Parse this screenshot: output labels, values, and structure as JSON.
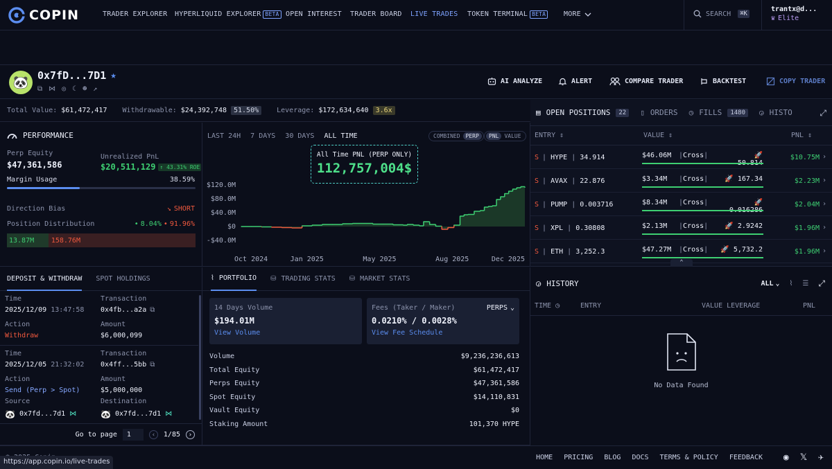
{
  "nav": {
    "logo": "COPIN",
    "items": [
      {
        "label": "TRADER EXPLORER",
        "beta": false,
        "active": false
      },
      {
        "label": "HYPERLIQUID EXPLORER",
        "beta": true,
        "active": false
      },
      {
        "label": "OPEN INTEREST",
        "beta": false,
        "active": false
      },
      {
        "label": "TRADER BOARD",
        "beta": false,
        "active": false
      },
      {
        "label": "LIVE TRADES",
        "beta": false,
        "active": true
      },
      {
        "label": "TOKEN TERMINAL",
        "beta": true,
        "active": false
      }
    ],
    "beta_label": "BETA",
    "more": "MORE",
    "search": "SEARCH",
    "shortcut": "⌘K",
    "user": "trantx@d...",
    "tier": "Elite"
  },
  "trader": {
    "address": "0x7fD...7D1",
    "buttons": [
      "AI ANALYZE",
      "ALERT",
      "COMPARE TRADER",
      "BACKTEST",
      "COPY TRADER"
    ]
  },
  "stats": {
    "total_value_label": "Total Value:",
    "total_value": "$61,472,417",
    "withdrawable_label": "Withdrawable:",
    "withdrawable": "$24,392,748",
    "withdrawable_pct": "51.50%",
    "leverage_label": "Leverage:",
    "leverage": "$172,634,640",
    "leverage_x": "3.6x"
  },
  "performance": {
    "title": "PERFORMANCE",
    "perp_equity_label": "Perp Equity",
    "perp_equity": "$47,361,586",
    "upnl_label": "Unrealized PnL",
    "upnl": "$20,511,129",
    "upnl_roe": "↑ 43.31% ROE",
    "margin_label": "Margin Usage",
    "margin_value": "38.59%",
    "margin_fraction": 0.3859,
    "direction_label": "Direction Bias",
    "direction_value": "SHORT",
    "distribution_label": "Position Distribution",
    "dist_long": "8.04%",
    "dist_short": "91.96%",
    "long_value": "13.87M",
    "short_value": "158.76M",
    "long_fraction": 0.0804
  },
  "chart_tabs": {
    "periods": [
      "LAST 24H",
      "7 DAYS",
      "30 DAYS",
      "ALL TIME"
    ],
    "active": "ALL TIME",
    "toggle1": [
      "COMBINED",
      "PERP"
    ],
    "toggle2": [
      "PNL",
      "VALUE"
    ]
  },
  "chart_data": {
    "type": "area",
    "title": "All Time PNL (PERP ONLY)",
    "headline": "112,757,004$",
    "yticks": [
      "$120.0M",
      "$80.0M",
      "$40.0M",
      "$0",
      "-$40.0M"
    ],
    "xticks": [
      "Oct 2024",
      "Jan 2025",
      "May 2025",
      "Aug 2025",
      "Dec 2025"
    ],
    "ylim": [
      -40,
      120
    ],
    "xlim": [
      0,
      14
    ],
    "x": [
      0,
      0.5,
      1,
      1.5,
      2,
      2.5,
      3,
      3.5,
      4,
      4.5,
      5,
      5.5,
      6,
      6.5,
      7,
      7.5,
      8,
      8.2,
      8.5,
      8.8,
      9,
      9.3,
      9.6,
      9.9,
      10.2,
      10.5,
      10.8,
      11,
      11.2,
      11.5,
      11.8,
      12,
      12.2,
      12.4,
      12.6,
      12.8,
      13,
      13.2,
      13.4,
      13.6,
      13.8,
      14
    ],
    "values": [
      0,
      0,
      -1,
      -2,
      -3,
      -4,
      2,
      4,
      6,
      6,
      8,
      9,
      9,
      7,
      7,
      5,
      4,
      6,
      4,
      2,
      14,
      6,
      1,
      -8,
      -3,
      4,
      30,
      34,
      35,
      44,
      46,
      56,
      58,
      60,
      78,
      86,
      95,
      102,
      108,
      112,
      115,
      113
    ]
  },
  "dw": {
    "tabs": [
      "DEPOSIT & WITHDRAW",
      "SPOT HOLDINGS"
    ],
    "time_label": "Time",
    "tx_label": "Transaction",
    "action_label": "Action",
    "amount_label": "Amount",
    "source_label": "Source",
    "dest_label": "Destination",
    "entries": [
      {
        "date": "2025/12/09",
        "time": "13:47:58",
        "tx": "0x4fb...a2a",
        "action": "Withdraw",
        "amount": "$6,000,099"
      },
      {
        "date": "2025/12/05",
        "time": "21:32:02",
        "tx": "0x4ff...5bb",
        "action": "Send (Perp > Spot)",
        "amount": "$5,000,000",
        "source": "0x7fd...7d1",
        "dest": "0x7fd...7d1"
      }
    ],
    "goto_label": "Go to page",
    "page": "1",
    "page_of": "1/85"
  },
  "portfolio": {
    "tabs": [
      "PORTFOLIO",
      "TRADING STATS",
      "MARKET STATS"
    ],
    "vol_label": "14 Days Volume",
    "vol_value": "$194.01M",
    "vol_link": "View Volume",
    "fee_label": "Fees (Taker / Maker)",
    "fee_type": "PERPS",
    "fee_value": "0.0210% / 0.0028%",
    "fee_link": "View Fee Schedule",
    "rows": [
      {
        "k": "Volume",
        "v": "$9,236,236,613"
      },
      {
        "k": "Total Equity",
        "v": "$61,472,417"
      },
      {
        "k": "Perps Equity",
        "v": "$47,361,586"
      },
      {
        "k": "Spot Equity",
        "v": "$14,110,831"
      },
      {
        "k": "Vault Equity",
        "v": "$0"
      },
      {
        "k": "Staking Amount",
        "v": "101,370 HYPE"
      }
    ]
  },
  "positions": {
    "tab_open": "OPEN POSITIONS",
    "open_count": "22",
    "tab_orders": "ORDERS",
    "tab_fills": "FILLS",
    "fills_count": "1480",
    "tab_history": "HISTO",
    "col_entry": "ENTRY",
    "col_value": "VALUE",
    "col_pnl": "PNL",
    "rows": [
      {
        "side": "S",
        "coin": "HYPE",
        "entry": "34.914",
        "value": "$46.06M",
        "margin": "Cross",
        "liq": "50.814",
        "pnl": "$10.75M"
      },
      {
        "side": "S",
        "coin": "AVAX",
        "entry": "22.876",
        "value": "$3.34M",
        "margin": "Cross",
        "liq": "167.34",
        "pnl": "$2.23M"
      },
      {
        "side": "S",
        "coin": "PUMP",
        "entry": "0.003716",
        "value": "$8.34M",
        "margin": "Cross",
        "liq": "0.016286",
        "pnl": "$2.04M"
      },
      {
        "side": "S",
        "coin": "XPL",
        "entry": "0.30808",
        "value": "$2.13M",
        "margin": "Cross",
        "liq": "2.9242",
        "pnl": "$1.96M"
      },
      {
        "side": "S",
        "coin": "ETH",
        "entry": "3,252.3",
        "value": "$47.27M",
        "margin": "Cross",
        "liq": "5,732.2",
        "pnl": "$1.96M"
      }
    ]
  },
  "history": {
    "title": "HISTORY",
    "filter": "ALL",
    "col_time": "TIME",
    "col_entry": "ENTRY",
    "col_value": "VALUE LEVERAGE",
    "col_pnl": "PNL",
    "empty": "No Data Found"
  },
  "footer": {
    "copyright": "© 2025 Copin",
    "links": [
      "HOME",
      "PRICING",
      "BLOG",
      "DOCS",
      "TERMS & POLICY",
      "FEEDBACK"
    ],
    "status_url": "https://app.copin.io/live-trades"
  }
}
